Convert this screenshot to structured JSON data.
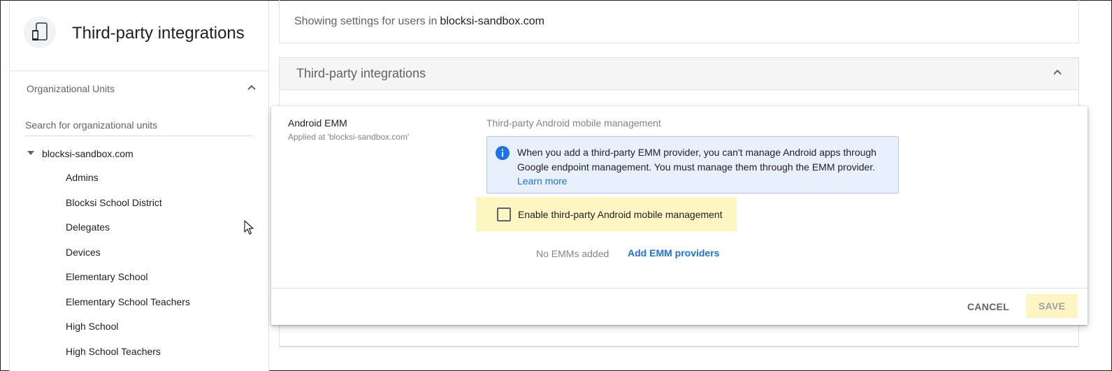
{
  "sidebar": {
    "app_icon": "devices-icon",
    "title": "Third-party integrations",
    "org_units_label": "Organizational Units",
    "search_placeholder": "Search for organizational units",
    "root_unit": "blocksi-sandbox.com",
    "units": [
      "Admins",
      "Blocksi School District",
      "Delegates",
      "Devices",
      "Elementary School",
      "Elementary School Teachers",
      "High School",
      "High School Teachers"
    ]
  },
  "main": {
    "showing_prefix": "Showing settings for users in",
    "domain": "blocksi-sandbox.com",
    "section_title": "Third-party integrations"
  },
  "setting": {
    "name": "Android EMM",
    "applied_at": "Applied at 'blocksi-sandbox.com'",
    "description": "Third-party Android mobile management",
    "info_text": "When you add a third-party EMM provider, you can't manage Android apps through Google endpoint management. You must manage them through the EMM provider.",
    "learn_more": "Learn more",
    "checkbox_label": "Enable third-party Android mobile management",
    "checkbox_checked": false,
    "no_emms": "No EMMs added",
    "add_emm": "Add EMM providers",
    "cancel": "CANCEL",
    "save": "SAVE"
  },
  "colors": {
    "accent": "#1a73e8",
    "highlight": "#fdf6c3",
    "info_bg": "#e8f0fe"
  }
}
